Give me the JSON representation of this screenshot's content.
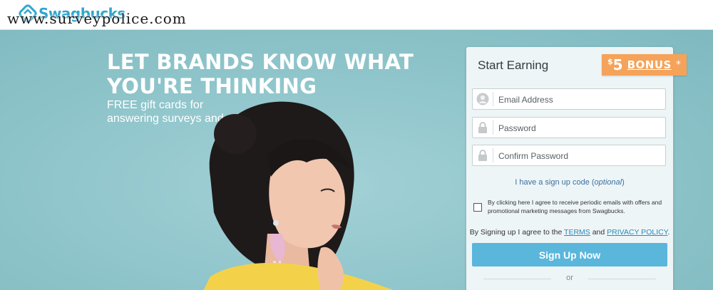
{
  "header": {
    "brand": "Swagbucks",
    "watermark": "www.surveypolice.com"
  },
  "hero": {
    "title_line1": "LET BRANDS KNOW WHAT",
    "title_line2": "YOU'RE THINKING",
    "subtitle": "FREE gift cards for answering surveys and more."
  },
  "signup": {
    "title": "Start Earning",
    "bonus": {
      "currency": "$",
      "amount": "5",
      "label": "BONUS",
      "mark": "*"
    },
    "email_placeholder": "Email Address",
    "password_placeholder": "Password",
    "confirm_placeholder": "Confirm Password",
    "code_link": "I have a sign up code (",
    "code_optional": "optional",
    "code_close": ")",
    "consent_text": "By clicking here I agree to receive periodic emails with offers and promotional marketing messages from Swagbucks.",
    "terms_prefix": "By Signing up I agree to the ",
    "terms_link": "TERMS",
    "terms_and": " and ",
    "privacy_link": "PRIVACY POLICY",
    "terms_suffix": ".",
    "button_label": "Sign Up Now",
    "or_label": "or"
  },
  "colors": {
    "hero_bg": "#8dc4ca",
    "button": "#5ab6db",
    "bonus": "#f5a35a",
    "brand": "#2fa7cf"
  },
  "icons": {
    "email": "user-icon",
    "password": "lock-icon",
    "confirm": "lock-icon"
  }
}
